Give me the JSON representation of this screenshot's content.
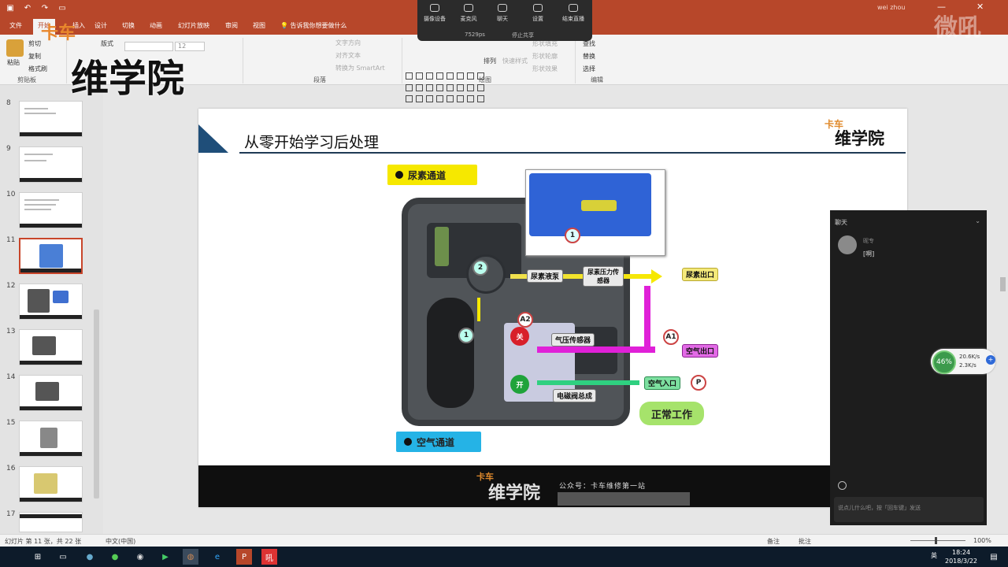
{
  "titlebar": {
    "user": "wei zhou",
    "qat": [
      "save-icon",
      "undo-icon",
      "redo-icon",
      "present-icon"
    ]
  },
  "tabs": {
    "file": "文件",
    "home": "开始",
    "insert": "插入",
    "design": "设计",
    "transitions": "切换",
    "animations": "动画",
    "slideshow": "幻灯片放映",
    "review": "审阅",
    "view": "视图",
    "tellme": "告诉我你想要做什么"
  },
  "ribbon": {
    "paste": "粘贴",
    "cut": "剪切",
    "copy": "复制",
    "format_painter": "格式刷",
    "clipboard": "剪贴板",
    "layout": "版式",
    "font_size": "12",
    "text_direction": "文字方向",
    "align_text": "对齐文本",
    "smartart": "转换为 SmartArt",
    "paragraph": "段落",
    "arrange": "排列",
    "quick_styles": "快速样式",
    "shape_fill": "形状填充",
    "shape_outline": "形状轮廓",
    "shape_effects": "形状效果",
    "drawing": "绘图",
    "find": "查找",
    "replace": "替换",
    "select": "选择",
    "editing": "编辑"
  },
  "meeting": {
    "camera": "摄像设备",
    "mic": "麦克风",
    "chat": "聊天",
    "settings": "设置",
    "end": "结束直播",
    "status": "7529ps",
    "stop_share": "停止共享"
  },
  "watermark": {
    "small": "卡车",
    "big": "维学院",
    "right": "微吼"
  },
  "thumbnails": [
    {
      "n": "8"
    },
    {
      "n": "9"
    },
    {
      "n": "10"
    },
    {
      "n": "11"
    },
    {
      "n": "12"
    },
    {
      "n": "13"
    },
    {
      "n": "14"
    },
    {
      "n": "15"
    },
    {
      "n": "16"
    },
    {
      "n": "17"
    }
  ],
  "slide": {
    "title": "从零开始学习后处理",
    "logo_small": "卡车",
    "logo_big": "维学院",
    "urea_channel": "尿素通道",
    "air_channel": "空气通道",
    "urea_pump": "尿素液泵",
    "urea_pressure_sensor": "尿素压力传感器",
    "urea_outlet": "尿素出口",
    "air_outlet": "空气出口",
    "air_inlet": "空气入口",
    "air_pressure_sensor": "气压传感器",
    "solenoid_assembly": "电磁阀总成",
    "normal": "正常工作",
    "off": "关",
    "on": "开",
    "c1": "1",
    "c2": "2",
    "a1": "A1",
    "a2": "A2",
    "p": "P",
    "footer_logo_small": "卡车",
    "footer_logo_big": "维学院",
    "footer_text": "公众号：卡车维修第一站"
  },
  "chat": {
    "title": "聊天",
    "sender": "昵专",
    "message": "[啊]",
    "placeholder": "说点儿什么吧，按「回车键」发送"
  },
  "net": {
    "percent": "46%",
    "up": "20.6K/s",
    "down": "2.3K/s"
  },
  "status": {
    "slide_info": "幻灯片 第 11 张，共 22 张",
    "lang": "中文(中国)",
    "notes": "备注",
    "comments": "批注",
    "zoom": "100%"
  },
  "taskbar": {
    "time": "18:24",
    "date": "2018/3/22",
    "ime": "英"
  },
  "colors": {
    "accent": "#b7472a",
    "urea_yellow": "#f6e800",
    "air_blue": "#25b3e6",
    "air_pink": "#e020d8",
    "green": "#a6e36b"
  }
}
